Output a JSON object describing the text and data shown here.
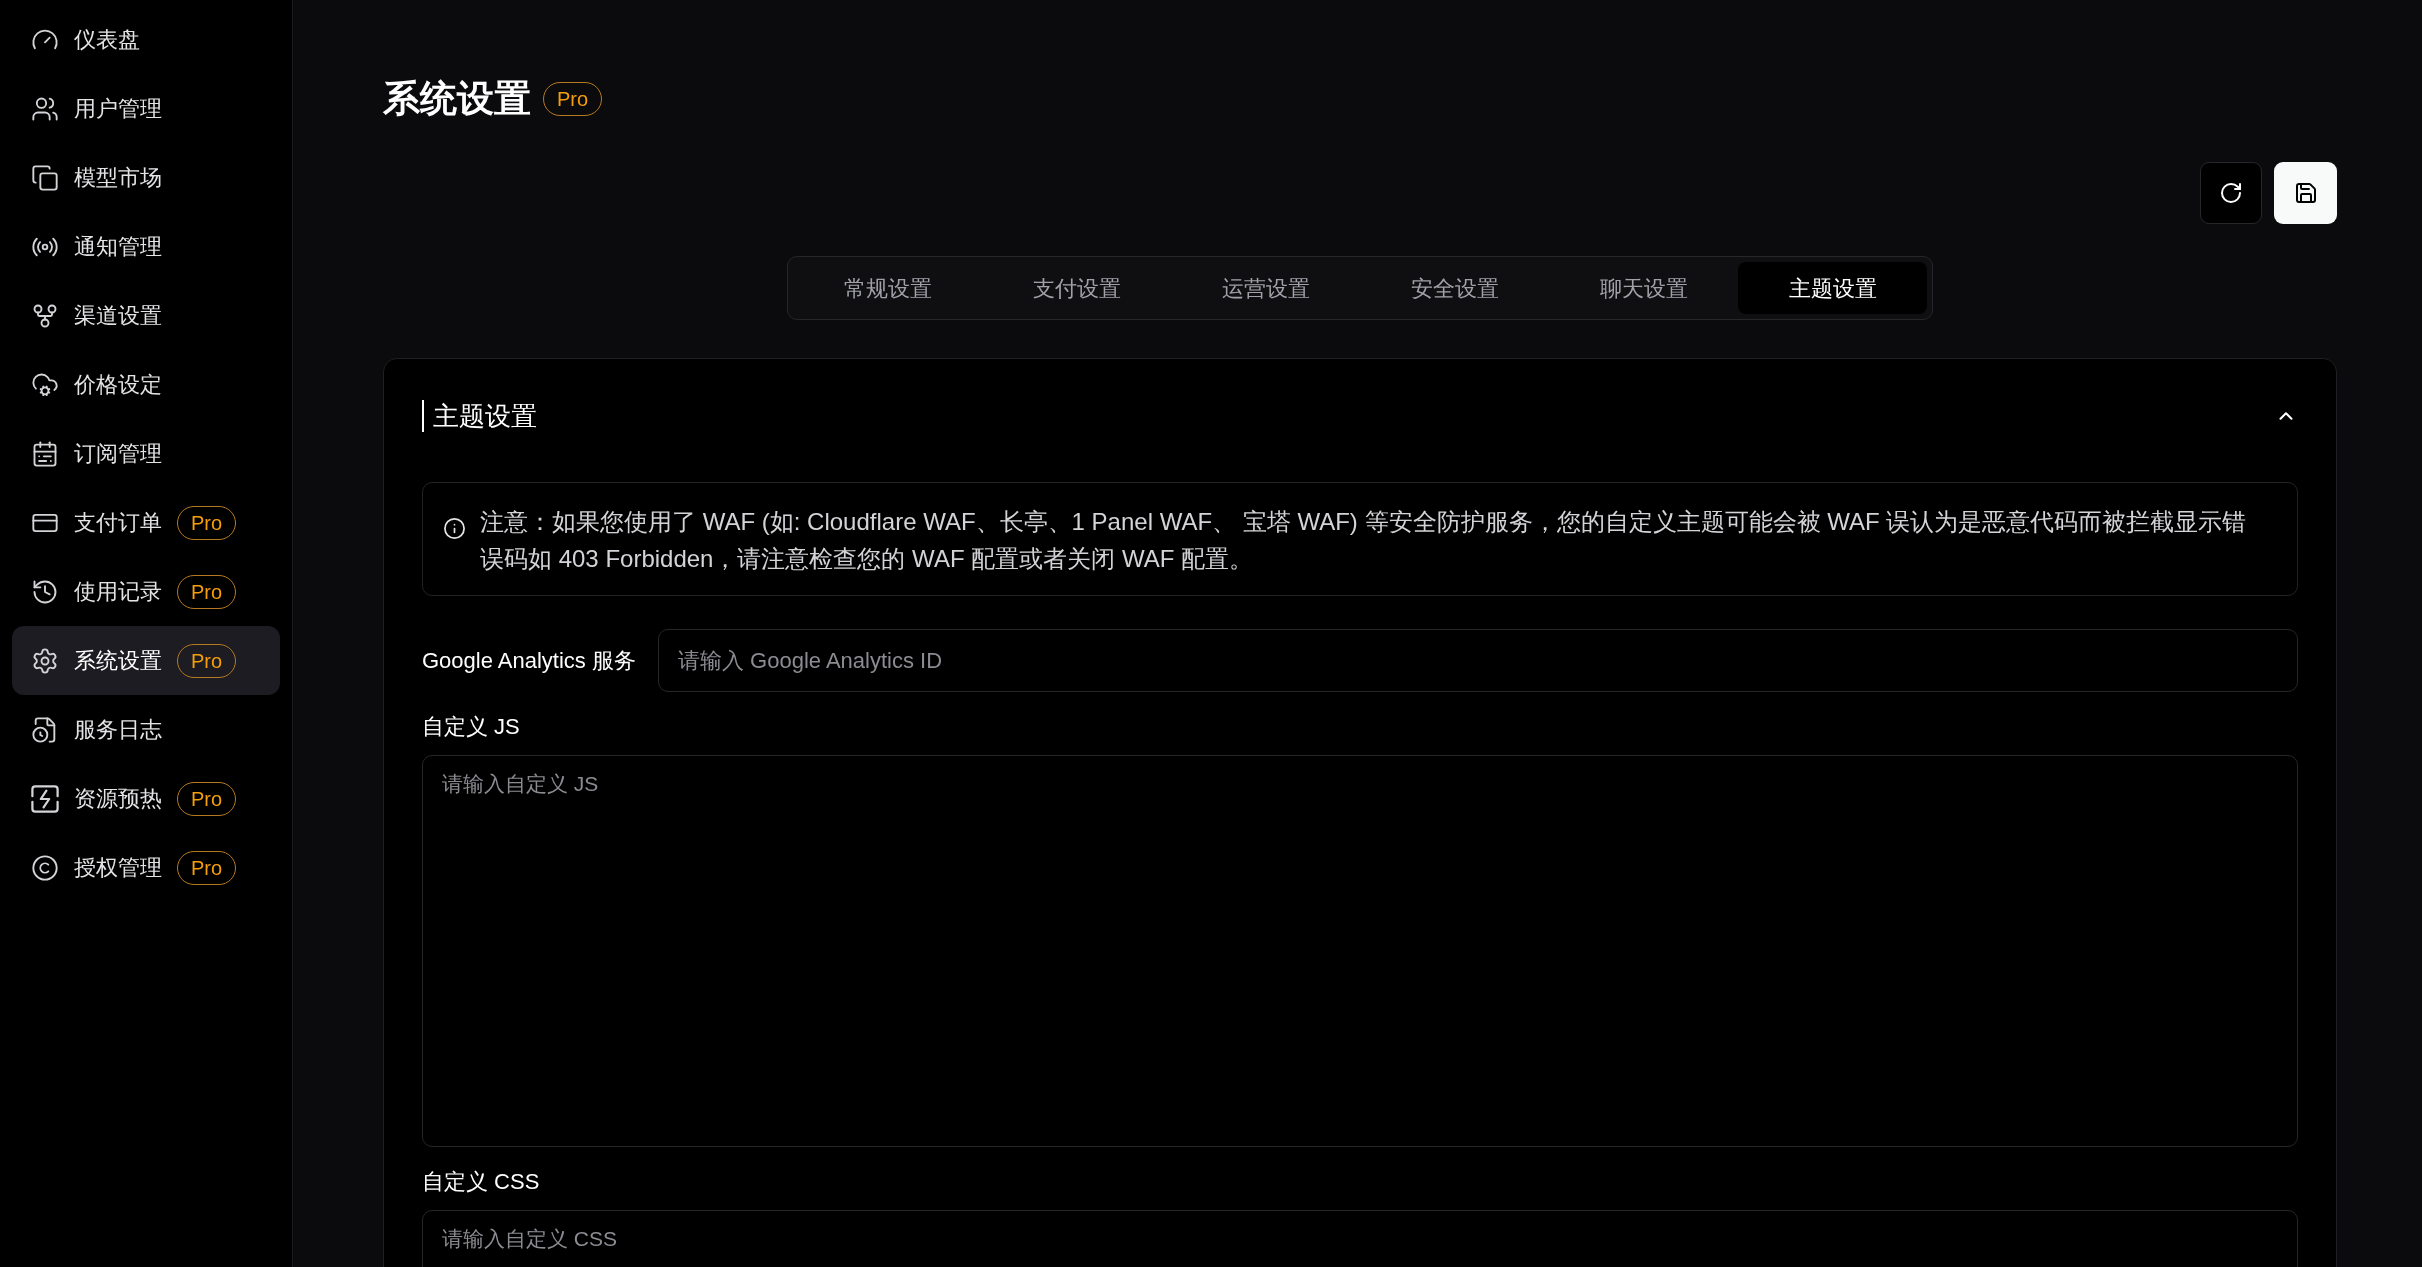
{
  "sidebar": {
    "items": [
      {
        "label": "仪表盘",
        "selected": false
      },
      {
        "label": "用户管理",
        "selected": false
      },
      {
        "label": "模型市场",
        "selected": false
      },
      {
        "label": "通知管理",
        "selected": false
      },
      {
        "label": "渠道设置",
        "selected": false
      },
      {
        "label": "价格设定",
        "selected": false
      },
      {
        "label": "订阅管理",
        "selected": false
      },
      {
        "label": "支付订单",
        "badge": "Pro",
        "selected": false
      },
      {
        "label": "使用记录",
        "badge": "Pro",
        "selected": false
      },
      {
        "label": "系统设置",
        "badge": "Pro",
        "selected": true
      },
      {
        "label": "服务日志",
        "selected": false
      },
      {
        "label": "资源预热",
        "badge": "Pro",
        "selected": false
      },
      {
        "label": "授权管理",
        "badge": "Pro",
        "selected": false
      }
    ]
  },
  "page": {
    "title": "系统设置",
    "badge": "Pro"
  },
  "tabs": [
    {
      "label": "常规设置",
      "selected": false
    },
    {
      "label": "支付设置",
      "selected": false
    },
    {
      "label": "运营设置",
      "selected": false
    },
    {
      "label": "安全设置",
      "selected": false
    },
    {
      "label": "聊天设置",
      "selected": false
    },
    {
      "label": "主题设置",
      "selected": true
    }
  ],
  "panel": {
    "title": "主题设置",
    "expanded": true,
    "notice": "注意：如果您使用了 WAF (如: Cloudflare WAF、长亭、1 Panel WAF、 宝塔 WAF) 等安全防护服务，您的自定义主题可能会被 WAF 误认为是恶意代码而被拦截显示错误码如 403 Forbidden，请注意检查您的 WAF 配置或者关闭 WAF 配置。",
    "fields": [
      {
        "kind": "input",
        "label": "Google Analytics 服务",
        "placeholder": "请输入 Google Analytics ID"
      },
      {
        "kind": "textarea",
        "label": "自定义 JS",
        "placeholder": "请输入自定义 JS"
      },
      {
        "kind": "textarea",
        "label": "自定义 CSS",
        "placeholder": "请输入自定义 CSS"
      }
    ]
  }
}
